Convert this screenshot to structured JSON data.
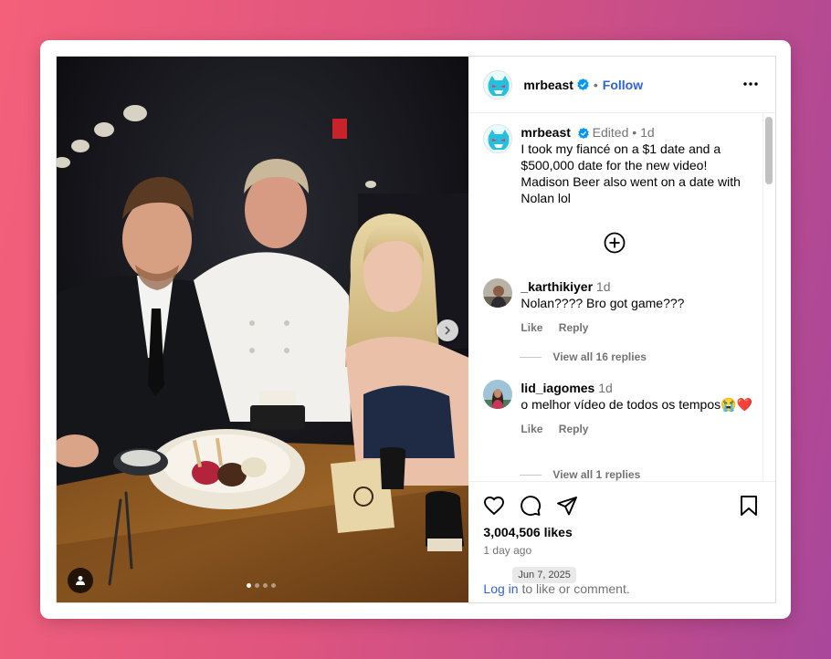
{
  "post": {
    "author": "mrbeast",
    "follow_label": "Follow",
    "separator": "•",
    "more_icon": "more-horizontal-icon"
  },
  "caption": {
    "author": "mrbeast",
    "edited": "Edited",
    "dot": "•",
    "time": "1d",
    "text": "I took my fiancé on a $1 date and a $500,000 date for the new video! Madison Beer also went on a date with Nolan lol"
  },
  "comments": [
    {
      "user": "_karthikiyer",
      "time": "1d",
      "text": "Nolan???? Bro got game???",
      "like": "Like",
      "reply": "Reply",
      "view_replies": "View all 16 replies"
    },
    {
      "user": "lid_iagomes",
      "time": "1d",
      "text": "o melhor vídeo de todos os tempos😭❤️",
      "like": "Like",
      "reply": "Reply",
      "view_replies": "View all 1 replies"
    }
  ],
  "footer": {
    "likes": "3,004,506 likes",
    "ago": "1 day ago",
    "tooltip": "Jun 7, 2025",
    "login_link": "Log in",
    "login_rest": " to like or comment."
  },
  "carousel": {
    "total": 4,
    "active": 1
  },
  "colors": {
    "link": "#2f62d9",
    "verified": "#0095f6",
    "muted": "#737373"
  }
}
